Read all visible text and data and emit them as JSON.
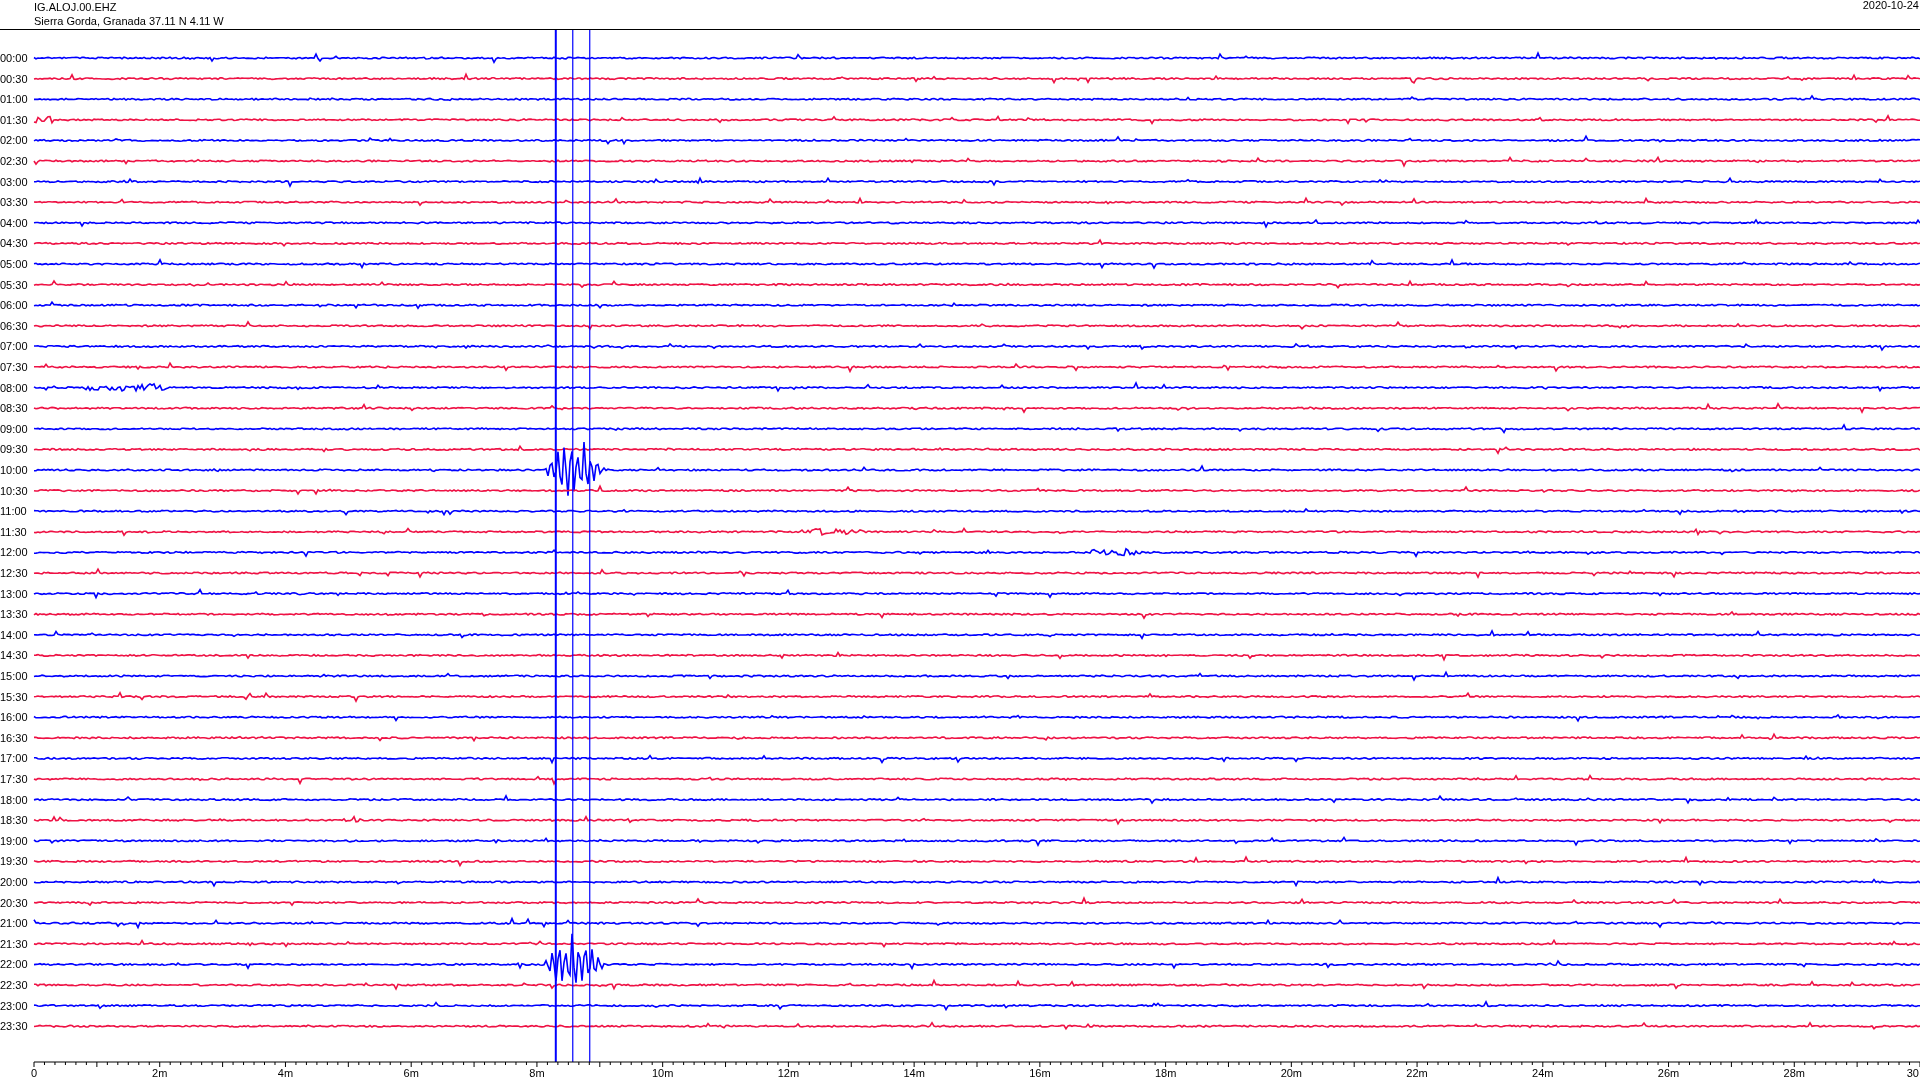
{
  "header": {
    "station": "IG.ALOJ.00.EHZ",
    "location": "Sierra Gorda, Granada  37.11 N 4.11 W",
    "date": "2020-10-24"
  },
  "rows": [
    {
      "label": "00:00",
      "color": "#0000ff"
    },
    {
      "label": "00:30",
      "color": "#ee1144"
    },
    {
      "label": "01:00",
      "color": "#0000ff"
    },
    {
      "label": "01:30",
      "color": "#ee1144"
    },
    {
      "label": "02:00",
      "color": "#0000ff"
    },
    {
      "label": "02:30",
      "color": "#ee1144"
    },
    {
      "label": "03:00",
      "color": "#0000ff"
    },
    {
      "label": "03:30",
      "color": "#ee1144"
    },
    {
      "label": "04:00",
      "color": "#0000ff"
    },
    {
      "label": "04:30",
      "color": "#ee1144"
    },
    {
      "label": "05:00",
      "color": "#0000ff"
    },
    {
      "label": "05:30",
      "color": "#ee1144"
    },
    {
      "label": "06:00",
      "color": "#0000ff"
    },
    {
      "label": "06:30",
      "color": "#ee1144"
    },
    {
      "label": "07:00",
      "color": "#0000ff"
    },
    {
      "label": "07:30",
      "color": "#ee1144"
    },
    {
      "label": "08:00",
      "color": "#0000ff"
    },
    {
      "label": "08:30",
      "color": "#ee1144"
    },
    {
      "label": "09:00",
      "color": "#0000ff"
    },
    {
      "label": "09:30",
      "color": "#ee1144"
    },
    {
      "label": "10:00",
      "color": "#0000ff"
    },
    {
      "label": "10:30",
      "color": "#ee1144"
    },
    {
      "label": "11:00",
      "color": "#0000ff"
    },
    {
      "label": "11:30",
      "color": "#ee1144"
    },
    {
      "label": "12:00",
      "color": "#0000ff"
    },
    {
      "label": "12:30",
      "color": "#ee1144"
    },
    {
      "label": "13:00",
      "color": "#0000ff"
    },
    {
      "label": "13:30",
      "color": "#ee1144"
    },
    {
      "label": "14:00",
      "color": "#0000ff"
    },
    {
      "label": "14:30",
      "color": "#ee1144"
    },
    {
      "label": "15:00",
      "color": "#0000ff"
    },
    {
      "label": "15:30",
      "color": "#ee1144"
    },
    {
      "label": "16:00",
      "color": "#0000ff"
    },
    {
      "label": "16:30",
      "color": "#ee1144"
    },
    {
      "label": "17:00",
      "color": "#0000ff"
    },
    {
      "label": "17:30",
      "color": "#ee1144"
    },
    {
      "label": "18:00",
      "color": "#0000ff"
    },
    {
      "label": "18:30",
      "color": "#ee1144"
    },
    {
      "label": "19:00",
      "color": "#0000ff"
    },
    {
      "label": "19:30",
      "color": "#ee1144"
    },
    {
      "label": "20:00",
      "color": "#0000ff"
    },
    {
      "label": "20:30",
      "color": "#ee1144"
    },
    {
      "label": "21:00",
      "color": "#0000ff"
    },
    {
      "label": "21:30",
      "color": "#ee1144"
    },
    {
      "label": "22:00",
      "color": "#0000ff"
    },
    {
      "label": "22:30",
      "color": "#ee1144"
    },
    {
      "label": "23:00",
      "color": "#0000ff"
    },
    {
      "label": "23:30",
      "color": "#ee1144"
    }
  ],
  "x_ticks": [
    "0",
    "2m",
    "4m",
    "6m",
    "8m",
    "10m",
    "12m",
    "14m",
    "16m",
    "18m",
    "20m",
    "22m",
    "24m",
    "26m",
    "28m",
    "30"
  ]
}
